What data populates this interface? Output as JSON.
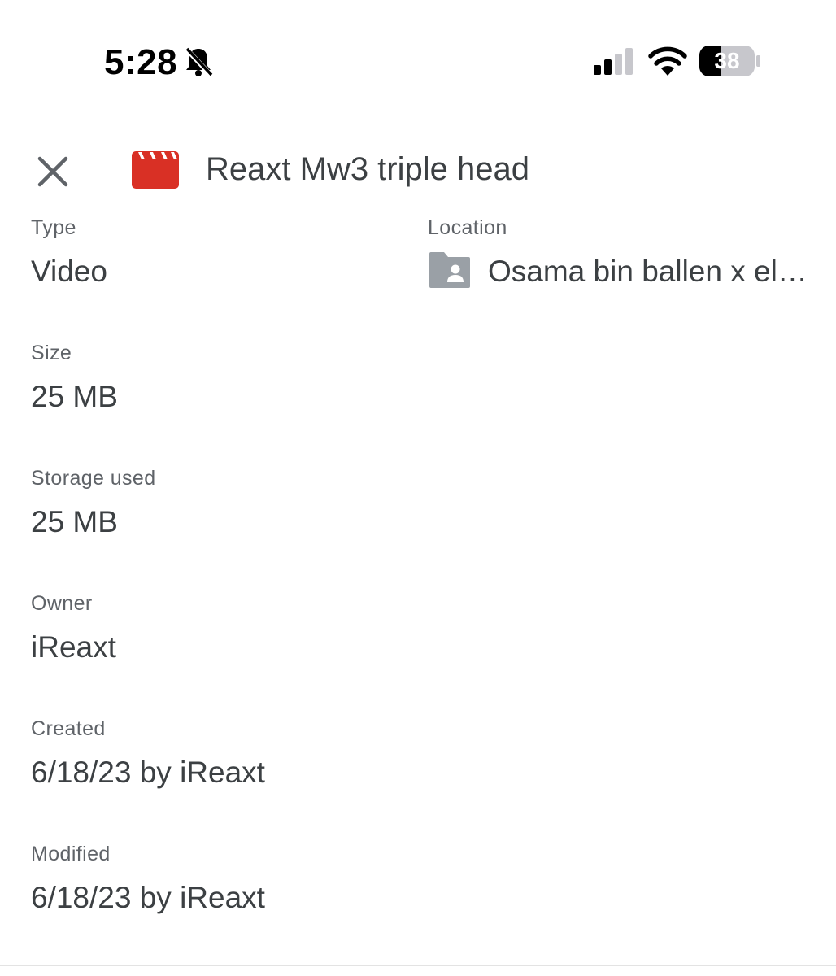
{
  "status_bar": {
    "time": "5:28",
    "battery": "38",
    "icons": [
      "bell-slash-icon",
      "cellular-signal-icon",
      "wifi-icon",
      "battery-icon"
    ]
  },
  "header": {
    "title": "Reaxt Mw3 triple head",
    "file_type_icon": "video-clapperboard-icon",
    "file_icon_color": "#d93025",
    "close_icon": "close-icon"
  },
  "details": {
    "type_label": "Type",
    "type_value": "Video",
    "location_label": "Location",
    "location_value": "Osama bin ballen x elephant",
    "location_icon": "shared-folder-icon",
    "size_label": "Size",
    "size_value": "25 MB",
    "storage_label": "Storage used",
    "storage_value": "25 MB",
    "owner_label": "Owner",
    "owner_value": "iReaxt",
    "created_label": "Created",
    "created_value": "6/18/23 by iReaxt",
    "modified_label": "Modified",
    "modified_value": "6/18/23 by iReaxt"
  },
  "colors": {
    "text_primary": "#3c4043",
    "text_secondary": "#5f6368",
    "folder_icon": "#9aa0a6",
    "video_icon": "#d93025"
  }
}
